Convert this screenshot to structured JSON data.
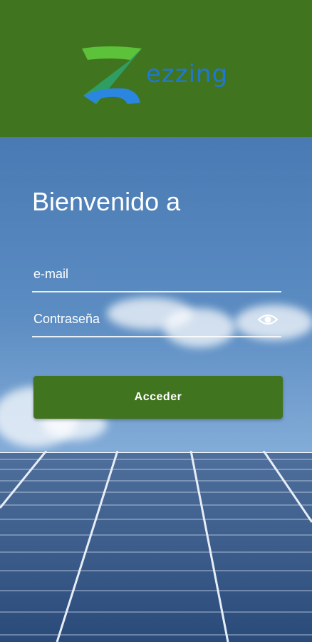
{
  "brand": {
    "name": "ezzing",
    "header_color": "#41741e",
    "accent": "#1e78d6"
  },
  "login": {
    "title": "Bienvenido a",
    "email_placeholder": "e-mail",
    "password_placeholder": "Contraseña",
    "submit_label": "Acceder",
    "show_password_icon": "eye-icon"
  }
}
